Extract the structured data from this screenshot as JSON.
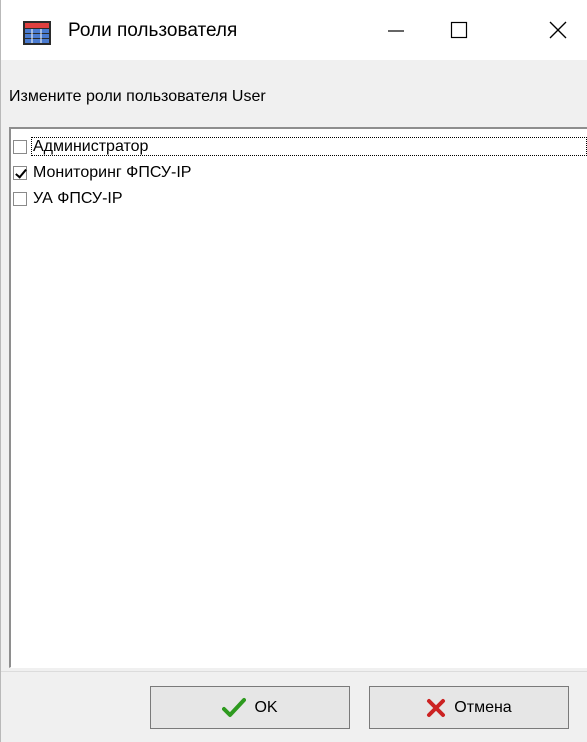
{
  "window": {
    "title": "Роли пользователя",
    "minimize_glyph": "—",
    "close_glyph": "✕",
    "icon": "app-grid-icon"
  },
  "prompt": "Измените роли пользователя User",
  "roles": [
    {
      "label": "Администратор",
      "checked": false,
      "focused": true
    },
    {
      "label": "Мониторинг ФПСУ-IP",
      "checked": true,
      "focused": false
    },
    {
      "label": "УА ФПСУ-IP",
      "checked": false,
      "focused": false
    }
  ],
  "buttons": {
    "ok_label": "OK",
    "cancel_label": "Отмена"
  },
  "colors": {
    "ok_check": "#2e9a1f",
    "cancel_x": "#cc2222",
    "window_bg": "#f0f0f0"
  }
}
